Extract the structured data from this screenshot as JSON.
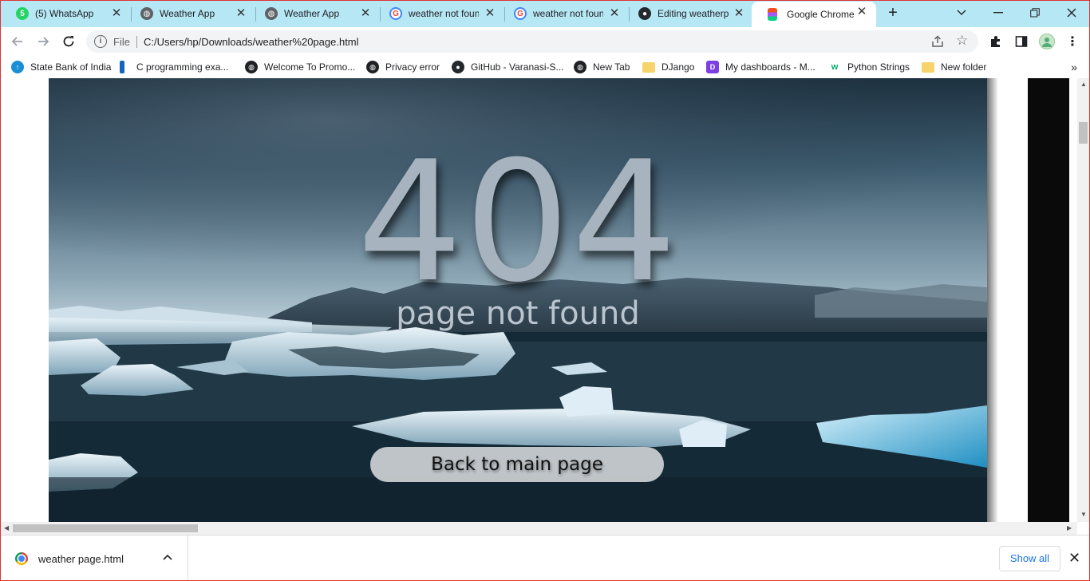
{
  "tabs": [
    {
      "title": "(5) WhatsApp",
      "icon": "whatsapp-icon"
    },
    {
      "title": "Weather App",
      "icon": "globe-icon"
    },
    {
      "title": "Weather App",
      "icon": "globe-icon"
    },
    {
      "title": "weather not found",
      "icon": "google-icon"
    },
    {
      "title": "weather not found",
      "icon": "google-icon"
    },
    {
      "title": "Editing weatherp",
      "icon": "github-icon"
    },
    {
      "title": "Google Chrome",
      "icon": "figma-icon",
      "active": true
    }
  ],
  "whatsapp_badge": "5",
  "address": {
    "scheme_label": "File",
    "url": "C:/Users/hp/Downloads/weather%20page.html"
  },
  "bookmarks": [
    {
      "label": "State Bank of India",
      "icon": "sbi-icon"
    },
    {
      "label": "C programming exa...",
      "icon": "bookmark-icon"
    },
    {
      "label": "Welcome To Promo...",
      "icon": "globe-icon"
    },
    {
      "label": "Privacy error",
      "icon": "globe-icon"
    },
    {
      "label": "GitHub - Varanasi-S...",
      "icon": "github-icon"
    },
    {
      "label": "New Tab",
      "icon": "globe-icon"
    },
    {
      "label": "DJango",
      "icon": "folder-icon"
    },
    {
      "label": "My dashboards - M...",
      "icon": "dashboard-icon"
    },
    {
      "label": "Python Strings",
      "icon": "w3-icon"
    },
    {
      "label": "New folder",
      "icon": "folder-icon"
    }
  ],
  "page": {
    "code": "404",
    "message": "page not found",
    "button_label": "Back to main page"
  },
  "download": {
    "file_name": "weather page.html",
    "show_all": "Show all"
  },
  "colors": {
    "tabstrip": "#b6e7f5",
    "link_blue": "#1a73e8"
  }
}
